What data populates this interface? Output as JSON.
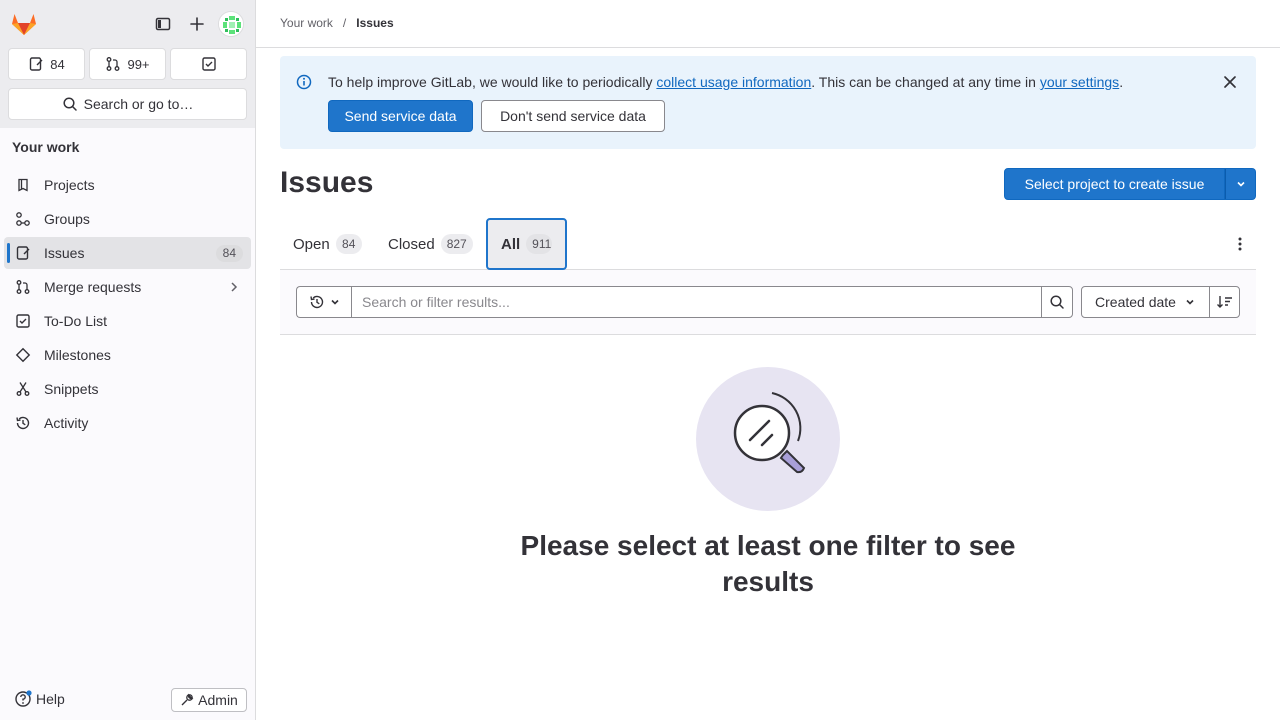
{
  "sidebar": {
    "counters": {
      "issues": "84",
      "merge_requests": "99+"
    },
    "search_label": "Search or go to…",
    "section_heading": "Your work",
    "items": [
      {
        "label": "Projects"
      },
      {
        "label": "Groups"
      },
      {
        "label": "Issues",
        "badge": "84"
      },
      {
        "label": "Merge requests"
      },
      {
        "label": "To-Do List"
      },
      {
        "label": "Milestones"
      },
      {
        "label": "Snippets"
      },
      {
        "label": "Activity"
      }
    ],
    "help_label": "Help",
    "admin_label": "Admin"
  },
  "breadcrumb": {
    "parent": "Your work",
    "separator": "/",
    "current": "Issues"
  },
  "alert": {
    "text_before": "To help improve GitLab, we would like to periodically ",
    "link1": "collect usage information",
    "text_middle": ". This can be changed at any time in ",
    "link2": "your settings",
    "text_after": ".",
    "primary_button": "Send service data",
    "secondary_button": "Don't send service data"
  },
  "page": {
    "title": "Issues",
    "create_button": "Select project to create issue"
  },
  "tabs": [
    {
      "label": "Open",
      "count": "84"
    },
    {
      "label": "Closed",
      "count": "827"
    },
    {
      "label": "All",
      "count": "911",
      "active": true
    }
  ],
  "filter": {
    "placeholder": "Search or filter results...",
    "sort_label": "Created date"
  },
  "empty_state": {
    "title": "Please select at least one filter to see results"
  },
  "colors": {
    "accent": "#1f75cb",
    "alert_bg": "#e9f3fc",
    "illustration_bg": "#e7e4f2"
  }
}
